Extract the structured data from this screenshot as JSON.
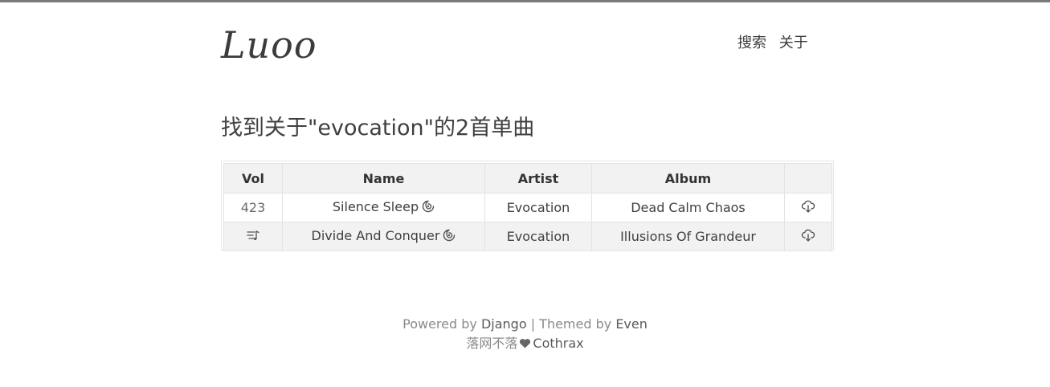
{
  "header": {
    "logo": "Luoo",
    "nav": [
      {
        "label": "搜索"
      },
      {
        "label": "关于"
      }
    ]
  },
  "main": {
    "title": "找到关于\"evocation\"的2首单曲",
    "table": {
      "headers": [
        "Vol",
        "Name",
        "Artist",
        "Album",
        ""
      ],
      "rows": [
        {
          "vol": "423",
          "vol_icon": "",
          "name": "Silence Sleep",
          "name_icon": "spiral-icon",
          "artist": "Evocation",
          "album": "Dead Calm Chaos",
          "action_icon": "cloud-download-icon"
        },
        {
          "vol": "",
          "vol_icon": "single-track-icon",
          "name": "Divide And Conquer",
          "name_icon": "spiral-icon",
          "artist": "Evocation",
          "album": "Illusions Of Grandeur",
          "action_icon": "cloud-download-icon"
        }
      ]
    }
  },
  "footer": {
    "powered_prefix": "Powered by ",
    "powered_link": "Django",
    "separator": " | Themed by ",
    "theme_link": "Even",
    "credit_prefix": "落网不落",
    "credit_icon": "heart-icon",
    "credit_link": "Cothrax"
  },
  "colors": {
    "top_bar": "#7a7a7a",
    "text": "#404040",
    "header_bg": "#f2f2f2",
    "footer_text": "#8a8a8a"
  }
}
